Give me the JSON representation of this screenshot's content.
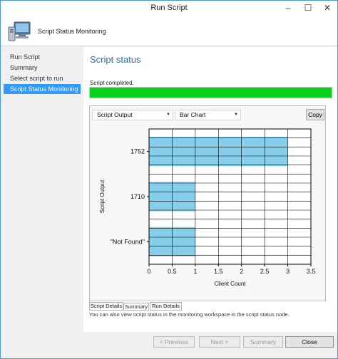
{
  "window": {
    "title": "Run Script",
    "minimize": "–",
    "maximize": "☐",
    "close": "✕"
  },
  "header": {
    "text": "Script Status Monitoring"
  },
  "nav": {
    "items": [
      {
        "label": "Run Script",
        "active": false
      },
      {
        "label": "Summary",
        "active": false
      },
      {
        "label": "Select script to run",
        "active": false
      },
      {
        "label": "Script Status Monitoring",
        "active": true
      }
    ]
  },
  "main": {
    "section_title": "Script status",
    "status_text": "Script completed.",
    "progress": 1.0,
    "output_select": {
      "value": "Script Output"
    },
    "chart_type_select": {
      "value": "Bar Chart"
    },
    "copy_label": "Copy",
    "tabs": [
      {
        "label": "Script Details",
        "active": false
      },
      {
        "label": "Summary",
        "active": true
      },
      {
        "label": "Run Details",
        "active": false
      }
    ],
    "info_text": "You can also view script status in the monitoring workspace in the script status node."
  },
  "footer": {
    "previous": "< Previous",
    "next": "Next >",
    "summary": "Summary",
    "close": "Close"
  },
  "colors": {
    "accent": "#3399ff",
    "progress": "#06d21d",
    "bar": "#87ceeb",
    "title_blue": "#2b6fb5"
  },
  "chart_data": {
    "type": "bar",
    "orientation": "horizontal",
    "categories": [
      "1752",
      "1710",
      "\"Not Found\""
    ],
    "values": [
      3,
      1,
      1
    ],
    "xlabel": "Client Count",
    "ylabel": "Script Output",
    "xlim": [
      0,
      3.5
    ],
    "xticks": [
      "0",
      "0.5",
      "1",
      "1.5",
      "2",
      "2.5",
      "3",
      "3.5"
    ],
    "grid": true
  }
}
